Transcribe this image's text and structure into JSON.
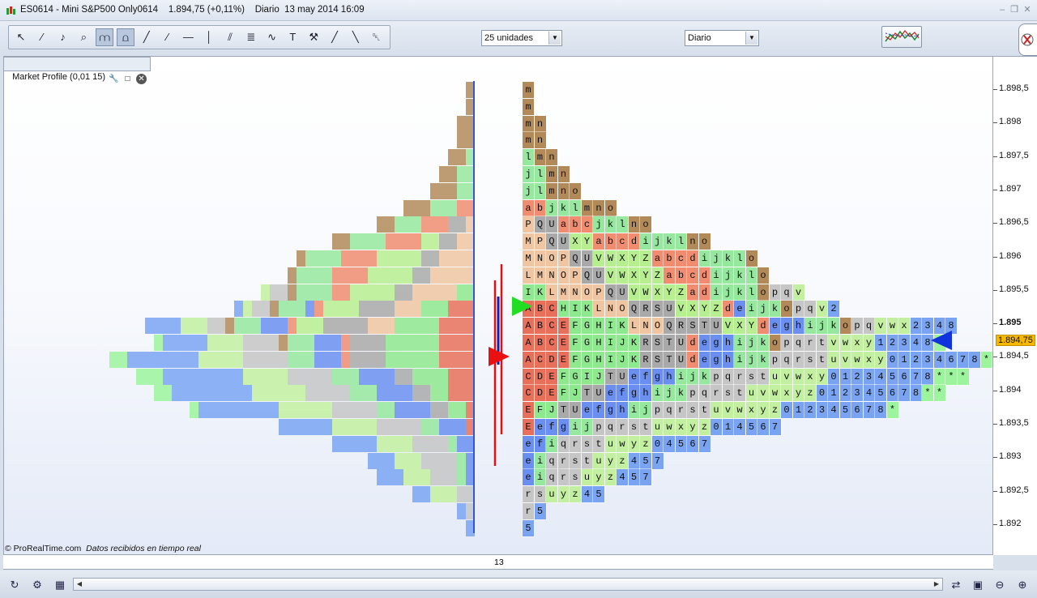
{
  "window": {
    "title": "ES0614 - Mini S&P500 Only0614    1.894,75 (+0,11%)    Diario  13 may 2014 16:09"
  },
  "toolbar": {
    "tools": [
      "cursor-icon",
      "ruler-icon",
      "alarm-bell-icon",
      "zoom-icon",
      "candle-tool-icon",
      "chart-tool-icon",
      "segment-icon",
      "line-icon",
      "horizontal-line-icon",
      "vertical-line-icon",
      "fan-icon",
      "fibonacci-icon",
      "wave-icon",
      "text-icon",
      "tools-icon",
      "trend-channel-icon",
      "channel-icon",
      "trash-icon"
    ],
    "units_value": "25 unidades",
    "period_value": "Diario"
  },
  "chart": {
    "label": "Market Profile (0,01 15)",
    "footer_brand": "© ProRealTime.com",
    "footer_status": "Datos recibidos en tiempo real",
    "x_label": "13",
    "price_levels": [
      "1.898,5",
      "1.898",
      "1.897,5",
      "1.897",
      "1.896,5",
      "1.896",
      "1.895,5",
      "1.895",
      "1.894,5",
      "1.894",
      "1.893,5",
      "1.893",
      "1.892,5",
      "1.892"
    ],
    "current_price": "1.894,75",
    "highlighted_level": "1.895",
    "tpo_rows": [
      "m",
      "m",
      "mn",
      "mn",
      "lmn",
      "jlmn",
      "jlmno",
      "abjklmno",
      "PQUabcjklno",
      "MPQUXYabcdijklno",
      "MNOPQUVWXYZabcdijklo",
      "LMNOPQUVWXYZabcdijklo",
      "IKLMNOPQUVWXYZadijklopqv",
      "ABCHIKLNOQRSUVXYZdeijkopqv2",
      "ABCEFGHIKLNOQRSTUVXYdeghijkopqvwx2348",
      "ABCEFGHIJKRSTUdeghijkopqrtvwxy12348*",
      "ACDEFGHIJKRSTUdeghijkpqrstuvwxy01234678**",
      "CDEFGIJTUefghijkpqrstuvwxy012345678***",
      "CDEFJTUefghijkpqrstuvwxyz012345678**",
      "EFJTUefghijpqrstuvwxyz012345678*",
      "Eefgijpqrstuwxyz014567",
      "efiqrstuwyz04567",
      "eiqrstuyz457",
      "eiqrsuyz457",
      "rsuyz45",
      "r5",
      "5"
    ]
  }
}
